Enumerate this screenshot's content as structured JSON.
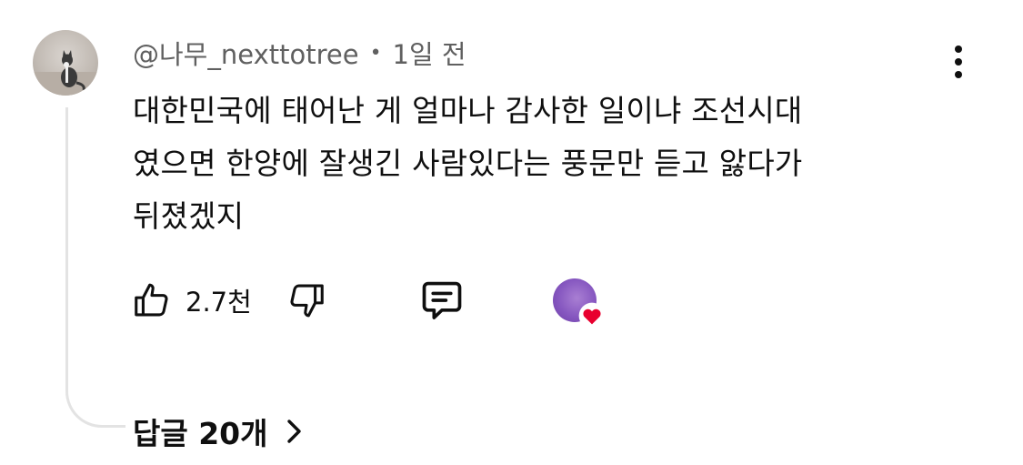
{
  "comment": {
    "author": "@나무_nexttotree",
    "separator": "•",
    "time": "1일 전",
    "lines": [
      "대한민국에 태어난 게 얼마나 감사한 일이냐 조선시대",
      "였으면 한양에 잘생긴 사람있다는 풍문만 듣고 앓다가",
      "뒤졌겠지"
    ],
    "like_count": "2.7천"
  },
  "replies": {
    "label": "답글 20개"
  },
  "icons": {
    "avatar": "cat-avatar",
    "more": "more-vertical-icon",
    "like": "thumbs-up-icon",
    "dislike": "thumbs-down-icon",
    "reply": "comment-icon",
    "creator_heart": "creator-heart-badge",
    "chevron": "chevron-right-icon"
  },
  "colors": {
    "text": "#0f0f0f",
    "secondary_text": "#606060",
    "heart": "#e8002f",
    "thread_line": "#e3e3e3"
  }
}
